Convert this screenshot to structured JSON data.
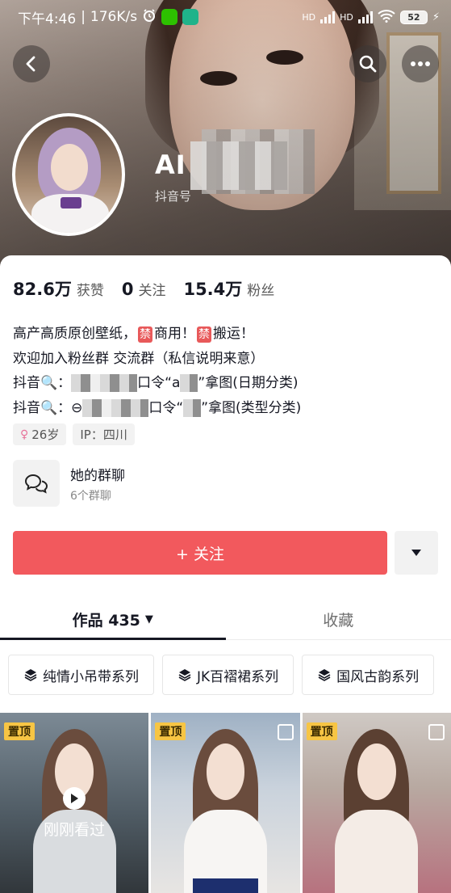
{
  "status_bar": {
    "time": "下午4:46",
    "speed": "176K/s",
    "battery": "52",
    "network_labels": [
      "HD",
      "HD"
    ]
  },
  "profile": {
    "name_visible": "AI",
    "sub_label": "抖音号"
  },
  "stats": [
    {
      "value": "82.6万",
      "label": "获赞"
    },
    {
      "value": "0",
      "label": "关注"
    },
    {
      "value": "15.4万",
      "label": "粉丝"
    }
  ],
  "bio": {
    "line1_a": "高产高质原创壁纸，",
    "ban1": "禁",
    "line1_b": "商用！",
    "ban2": "禁",
    "line1_c": "搬运！",
    "line2": "欢迎加入粉丝群 交流群（私信说明来意）",
    "line3_a": "抖音",
    "line3_b": "口令“a",
    "line3_c": "”拿图(日期分类)",
    "line4_a": "抖音",
    "line4_b": "口令“",
    "line4_c": "”拿图(类型分类)"
  },
  "tags": [
    {
      "label": "26岁"
    },
    {
      "label": "IP：四川"
    }
  ],
  "group": {
    "title": "她的群聊",
    "subtitle": "6个群聊"
  },
  "follow_button": "+ 关注",
  "tabs": [
    {
      "label": "作品 435"
    },
    {
      "label": "收藏"
    }
  ],
  "collections": [
    {
      "label": "纯情小吊带系列"
    },
    {
      "label": "JK百褶裙系列"
    },
    {
      "label": "国风古韵系列"
    }
  ],
  "videos": [
    {
      "badge": "置顶",
      "overlay": "刚刚看过"
    },
    {
      "badge": "置顶"
    },
    {
      "badge": "置顶"
    }
  ],
  "colors": {
    "accent": "#f2595d",
    "ban_badge": "#e8595a",
    "pin_badge": "#f7c544"
  }
}
